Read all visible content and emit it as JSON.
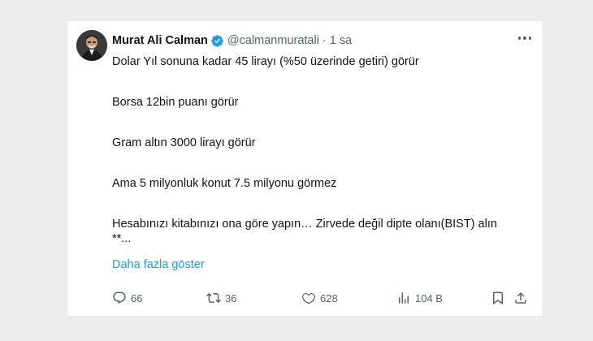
{
  "tweet": {
    "author_name": "Murat Ali Calman",
    "handle": "@calmanmuratali",
    "separator": "·",
    "time": "1 sa",
    "lines": [
      "Dolar Yıl sonuna kadar 45 lirayı (%50 üzerinde getiri) görür",
      "Borsa 12bin puanı görür",
      "Gram altın 3000 lirayı görür",
      "Ama 5 milyonluk konut 7.5 milyonu görmez",
      "Hesabınızı kitabınızı ona göre yapın… Zirvede değil dipte olanı(BIST) alın",
      "**..."
    ],
    "show_more": "Daha fazla göster"
  },
  "actions": {
    "replies": "66",
    "retweets": "36",
    "likes": "628",
    "views": "104 B"
  },
  "icons": {
    "verified": "verified-badge-icon",
    "more": "more-options-icon",
    "reply": "reply-icon",
    "retweet": "retweet-icon",
    "like": "heart-icon",
    "views": "views-chart-icon",
    "bookmark": "bookmark-icon",
    "share": "share-icon"
  },
  "colors": {
    "accent": "#1d9bf0",
    "muted": "#536471",
    "text": "#0f1419"
  }
}
